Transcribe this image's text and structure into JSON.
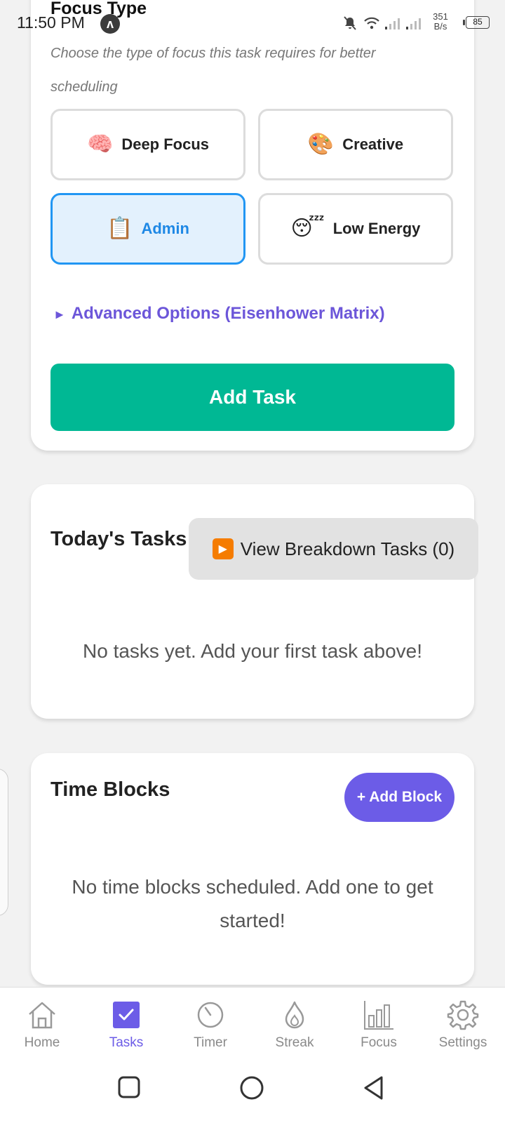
{
  "status_bar": {
    "time": "11:50 PM",
    "app_badge": "ʌ",
    "speed_value": "351",
    "speed_unit": "B/s",
    "battery": "85"
  },
  "focus": {
    "title": "Focus Type",
    "description": "Choose the type of focus this task requires for better scheduling",
    "options": [
      {
        "emoji": "🧠",
        "label": "Deep Focus",
        "selected": false
      },
      {
        "emoji": "🎨",
        "label": "Creative",
        "selected": false
      },
      {
        "emoji": "📋",
        "label": "Admin",
        "selected": true
      },
      {
        "emoji": "😴",
        "label": "Low Energy",
        "selected": false
      }
    ],
    "advanced_toggle_icon": "►",
    "advanced_label": "Advanced Options (Eisenhower Matrix)",
    "add_task_label": "Add Task"
  },
  "todays_tasks": {
    "title": "Today's Tasks",
    "breakdown_icon": "▶",
    "breakdown_label": "View Breakdown Tasks (0)",
    "empty_message": "No tasks yet. Add your first task above!"
  },
  "time_blocks": {
    "title": "Time Blocks",
    "add_block_label": "+ Add Block",
    "empty_message": "No time blocks scheduled. Add one to get started!"
  },
  "bottom_nav": {
    "items": [
      {
        "icon": "home-icon",
        "label": "Home"
      },
      {
        "icon": "tasks-icon",
        "label": "Tasks"
      },
      {
        "icon": "timer-icon",
        "label": "Timer"
      },
      {
        "icon": "flame-icon",
        "label": "Streak"
      },
      {
        "icon": "bar-chart-icon",
        "label": "Focus"
      },
      {
        "icon": "gear-icon",
        "label": "Settings"
      }
    ],
    "active_index": 1
  },
  "colors": {
    "accent_purple": "#6c5ce7",
    "primary_green": "#00b894",
    "selected_blue": "#2196f3"
  }
}
